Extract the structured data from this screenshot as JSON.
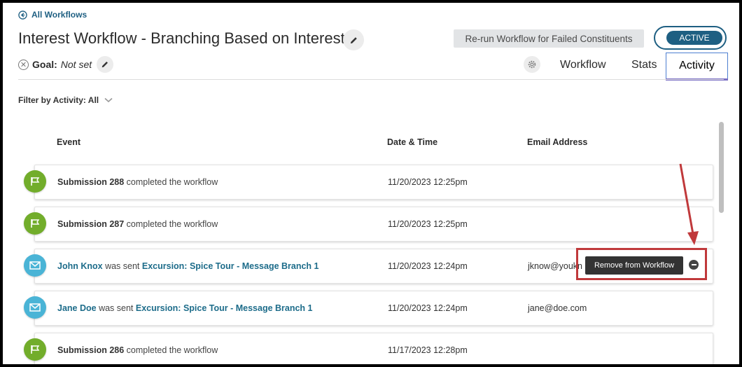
{
  "header": {
    "back_label": "All Workflows",
    "title": "Interest Workflow - Branching Based on Interest",
    "goal_label": "Goal:",
    "goal_value": "Not set",
    "rerun_label": "Re-run Workflow for Failed Constituents",
    "status_label": "ACTIVE"
  },
  "tabs": [
    {
      "label": "Workflow",
      "active": false
    },
    {
      "label": "Stats",
      "active": false
    },
    {
      "label": "Activity",
      "active": true
    }
  ],
  "filter": {
    "label": "Filter by Activity: All"
  },
  "table": {
    "columns": [
      "Event",
      "Date & Time",
      "Email Address"
    ],
    "rows": [
      {
        "icon": "flag-icon",
        "subject": "Submission 288",
        "action": " completed the workflow",
        "date": "11/20/2023 12:25pm",
        "email": ""
      },
      {
        "icon": "flag-icon",
        "subject": "Submission 287",
        "action": " completed the workflow",
        "date": "11/20/2023 12:25pm",
        "email": ""
      },
      {
        "icon": "mail-icon",
        "subject": "John Knox",
        "action": " was sent ",
        "link": "Excursion: Spice Tour - Message Branch 1",
        "date": "11/20/2023 12:24pm",
        "email": "jknow@youkn"
      },
      {
        "icon": "mail-icon",
        "subject": "Jane Doe",
        "action": " was sent ",
        "link": "Excursion: Spice Tour - Message Branch 1",
        "date": "11/20/2023 12:24pm",
        "email": "jane@doe.com"
      },
      {
        "icon": "flag-icon",
        "subject": "Submission 286",
        "action": " completed the workflow",
        "date": "11/17/2023 12:28pm",
        "email": ""
      }
    ]
  },
  "tooltip": {
    "label": "Remove from Workflow"
  },
  "colors": {
    "accent": "#1e5f82",
    "link": "#1d6c8a",
    "flag_green": "#72ad2b",
    "mail_blue": "#4ab4d6",
    "highlight_red": "#c0393b"
  }
}
